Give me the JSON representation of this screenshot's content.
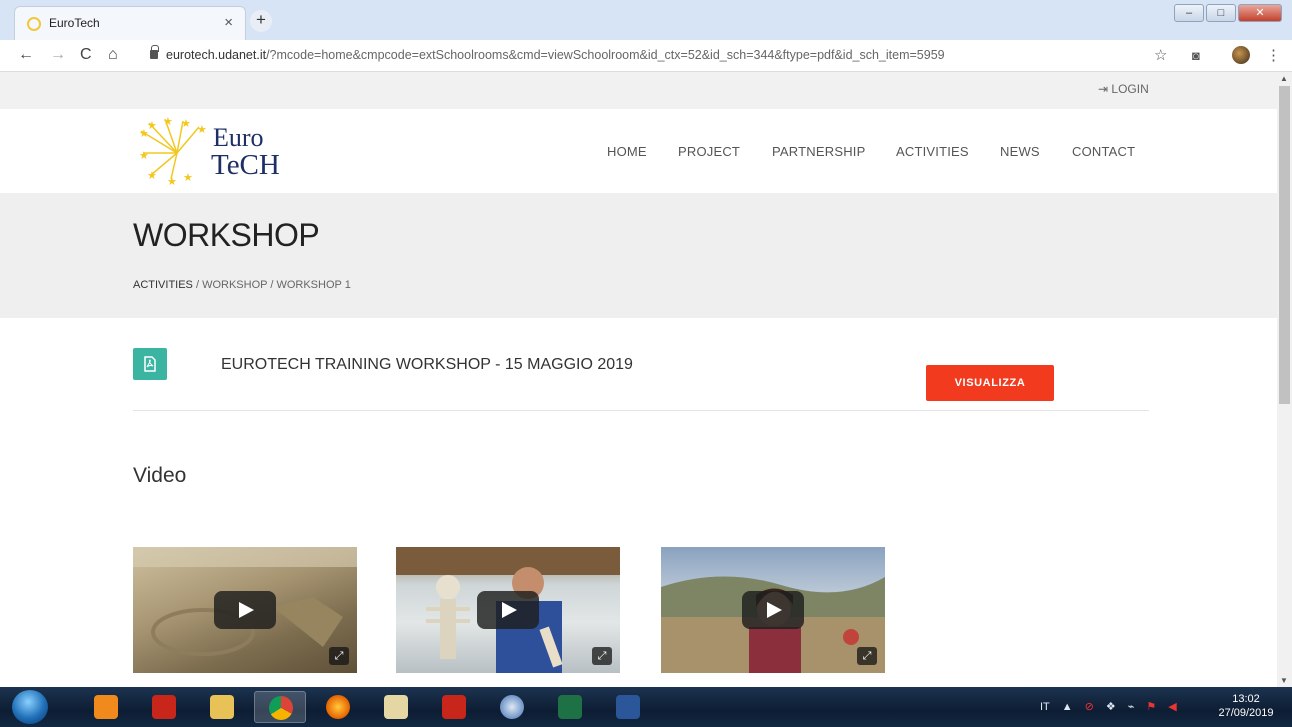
{
  "browser": {
    "tab_title": "EuroTech",
    "tab_close": "×",
    "new_tab": "+",
    "url_domain": "eurotech.udanet.it",
    "url_rest": "/?mcode=home&cmpcode=extSchoolrooms&cmd=viewSchoolroom&id_ctx=52&id_sch=344&ftype=pdf&id_sch_item=5959",
    "back": "←",
    "forward": "→",
    "reload": "C",
    "home": "⌂",
    "star": "☆",
    "camera": "◙",
    "menu": "⋮"
  },
  "site": {
    "login": "LOGIN",
    "logo_line1": "Euro",
    "logo_line2": "TeCH",
    "nav": [
      "HOME",
      "PROJECT",
      "PARTNERSHIP",
      "ACTIVITIES",
      "NEWS",
      "CONTACT"
    ]
  },
  "page": {
    "title": "WORKSHOP",
    "breadcrumb": [
      "ACTIVITIES",
      "WORKSHOP",
      "WORKSHOP 1"
    ],
    "document_title": "EUROTECH TRAINING WORKSHOP - 15 MAGGIO 2019",
    "visualize_label": "VISUALIZZA",
    "video_heading": "Video"
  },
  "taskbar": {
    "lang": "IT",
    "time": "13:02",
    "date": "27/09/2019"
  },
  "colors": {
    "accent_red": "#f23a1e",
    "pdf_teal": "#3bb5a2",
    "logo_navy": "#1d2f66"
  }
}
